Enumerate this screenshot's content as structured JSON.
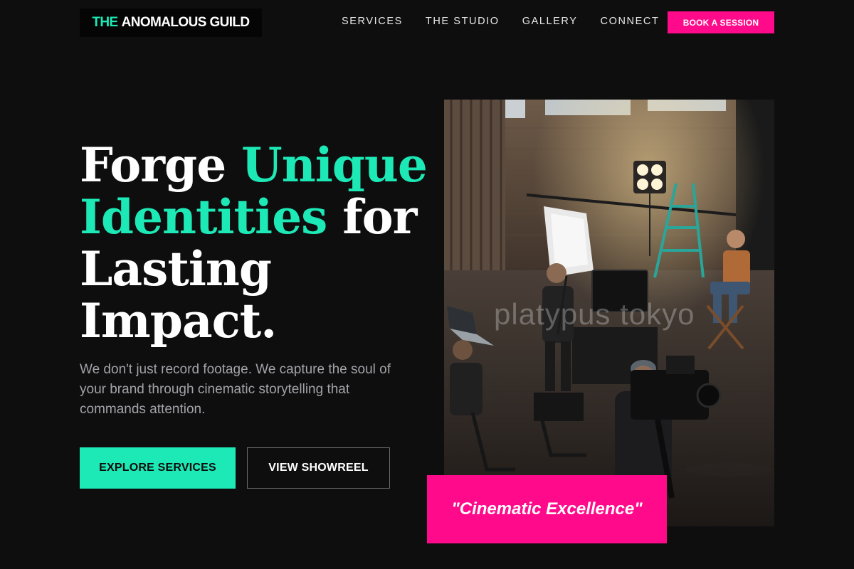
{
  "header": {
    "logo_accent": "THE",
    "logo_rest": "ANOMALOUS GUILD",
    "nav": [
      "SERVICES",
      "THE STUDIO",
      "GALLERY",
      "CONNECT"
    ],
    "cta_label": "BOOK A SESSION"
  },
  "hero": {
    "title_1": "Forge ",
    "title_2": "Unique",
    "title_3": "Identities",
    "title_4": " for",
    "title_5": "Lasting",
    "title_6": "Impact.",
    "description": "We don't just record footage. We capture the soul of your brand through cinematic storytelling that commands attention.",
    "primary_button": "EXPLORE SERVICES",
    "secondary_button": "VIEW SHOWREEL"
  },
  "image": {
    "watermark": "platypus tokyo"
  },
  "quote": "\"Cinematic Excellence\"",
  "colors": {
    "background": "#0e0e0f",
    "accent_teal": "#1de9b6",
    "accent_pink": "#ff0a8a",
    "muted_text": "#a3a3a8"
  }
}
